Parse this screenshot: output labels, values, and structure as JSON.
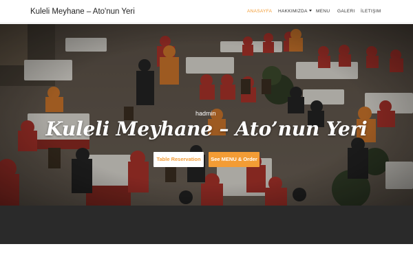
{
  "site": {
    "brand": "Kuleli Meyhane – Ato'nun Yeri"
  },
  "nav": {
    "items": [
      {
        "label": "ANASAYFA",
        "active": true
      },
      {
        "label": "HAKKIMIZDA",
        "dropdown": true
      },
      {
        "label": "MENU"
      },
      {
        "label": "GALERI"
      },
      {
        "label": "İLETIŞIM"
      }
    ]
  },
  "hero": {
    "author": "hadmin",
    "title": "Kuleli Meyhane – Ato’nun Yeri",
    "buttons": {
      "reservation": "Table Reservation",
      "menu": "See MENU & Order"
    }
  },
  "colors": {
    "accent": "#f39c35",
    "dark_band": "#2a2a2a"
  }
}
